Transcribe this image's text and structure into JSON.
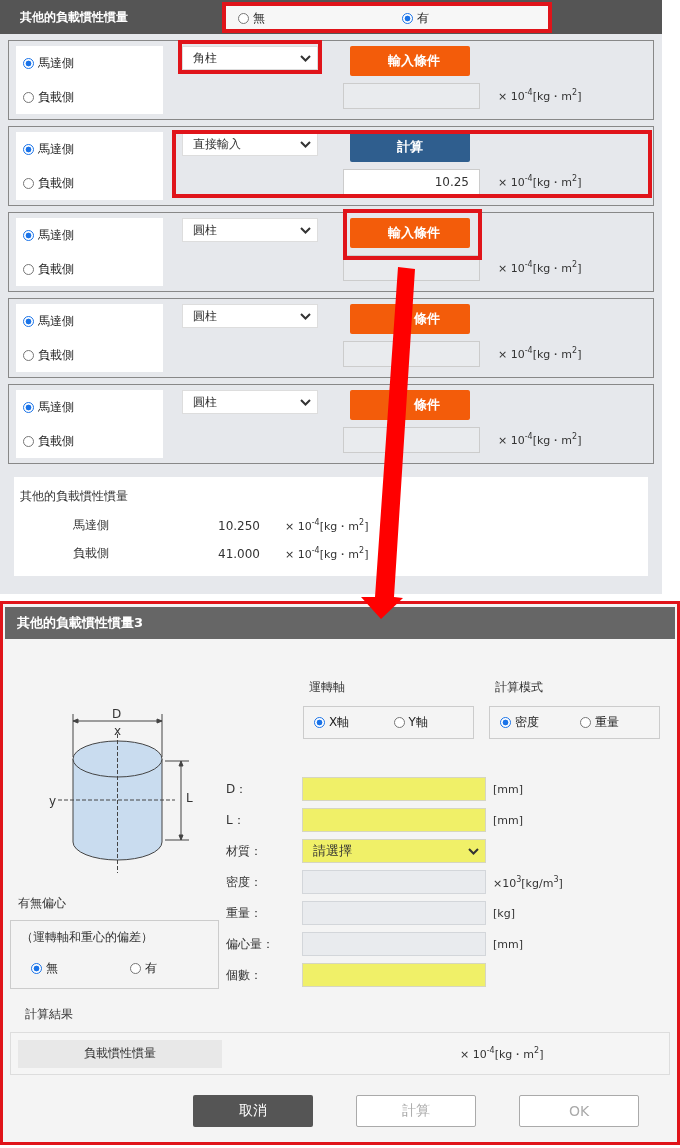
{
  "section": {
    "title": "其他的負載慣性慣量",
    "options": [
      {
        "label": "無",
        "selected": false
      },
      {
        "label": "有",
        "selected": true
      }
    ]
  },
  "rows": [
    {
      "sides": [
        {
          "label": "馬達側",
          "selected": true
        },
        {
          "label": "負載側",
          "selected": false
        }
      ],
      "shape": "角柱",
      "button": {
        "kind": "input",
        "label": "輸入條件"
      },
      "unit": "× 10$^{-4}$[kg・m$^{2}$]"
    },
    {
      "sides": [
        {
          "label": "馬達側",
          "selected": true
        },
        {
          "label": "負載側",
          "selected": false
        }
      ],
      "shape": "直接輸入",
      "button": {
        "kind": "calculate",
        "label": "計算"
      },
      "value": "10.25",
      "unit": "× 10$^{-4}$[kg・m$^{2}$]"
    },
    {
      "sides": [
        {
          "label": "馬達側",
          "selected": true
        },
        {
          "label": "負載側",
          "selected": false
        }
      ],
      "shape": "圓柱",
      "button": {
        "kind": "input",
        "label": "輸入條件"
      },
      "unit": "× 10$^{-4}$[kg・m$^{2}$]"
    },
    {
      "sides": [
        {
          "label": "馬達側",
          "selected": true
        },
        {
          "label": "負載側",
          "selected": false
        }
      ],
      "shape": "圓柱",
      "button": {
        "kind": "input",
        "label": "條件"
      },
      "unit": "× 10$^{-4}$[kg・m$^{2}$]"
    },
    {
      "sides": [
        {
          "label": "馬達側",
          "selected": true
        },
        {
          "label": "負載側",
          "selected": false
        }
      ],
      "shape": "圓柱",
      "button": {
        "kind": "input",
        "label": "條件"
      },
      "unit": "× 10$^{-4}$[kg・m$^{2}$]"
    }
  ],
  "summary": {
    "title": "其他的負載慣性慣量",
    "rows": [
      {
        "label": "馬達側",
        "value": "10.250",
        "unit": "× 10$^{-4}$[kg・m$^{2}$]"
      },
      {
        "label": "負載側",
        "value": "41.000",
        "unit": "× 10$^{-4}$[kg・m$^{2}$]"
      }
    ]
  },
  "dialog": {
    "title": "其他的負載慣性慣量3",
    "figure_labels": [
      "D",
      "x",
      "y",
      "L"
    ],
    "axis": {
      "title": "運轉軸",
      "options": [
        {
          "label": "X軸",
          "selected": true
        },
        {
          "label": "Y軸",
          "selected": false
        }
      ]
    },
    "mode": {
      "title": "計算模式",
      "options": [
        {
          "label": "密度",
          "selected": true
        },
        {
          "label": "重量",
          "selected": false
        }
      ]
    },
    "fields": [
      {
        "label": "D：",
        "kind": "required",
        "unit": "[mm]"
      },
      {
        "label": "L：",
        "kind": "required",
        "unit": "[mm]"
      },
      {
        "label": "材質：",
        "kind": "select",
        "value": "請選擇"
      },
      {
        "label": "密度：",
        "kind": "readonly",
        "unit": "×10$^{3}$[kg/m$^{3}$]"
      },
      {
        "label": "重量：",
        "kind": "readonly",
        "unit": "[kg]"
      },
      {
        "label": "偏心量：",
        "kind": "readonly",
        "unit": "[mm]"
      },
      {
        "label": "個數：",
        "kind": "required"
      }
    ],
    "eccentric": {
      "title": "有無偏心",
      "note": "（運轉軸和重心的偏差）",
      "options": [
        {
          "label": "無",
          "selected": true
        },
        {
          "label": "有",
          "selected": false
        }
      ]
    },
    "result": {
      "title": "計算結果",
      "label": "負載慣性慣量",
      "unit": "× 10$^{-4}$[kg・m$^{2}$]"
    },
    "buttons": [
      {
        "kind": "cancel",
        "label": "取消",
        "disabled": false
      },
      {
        "kind": "plain",
        "label": "計算",
        "disabled": true
      },
      {
        "kind": "plain",
        "label": "OK",
        "disabled": true
      }
    ]
  }
}
